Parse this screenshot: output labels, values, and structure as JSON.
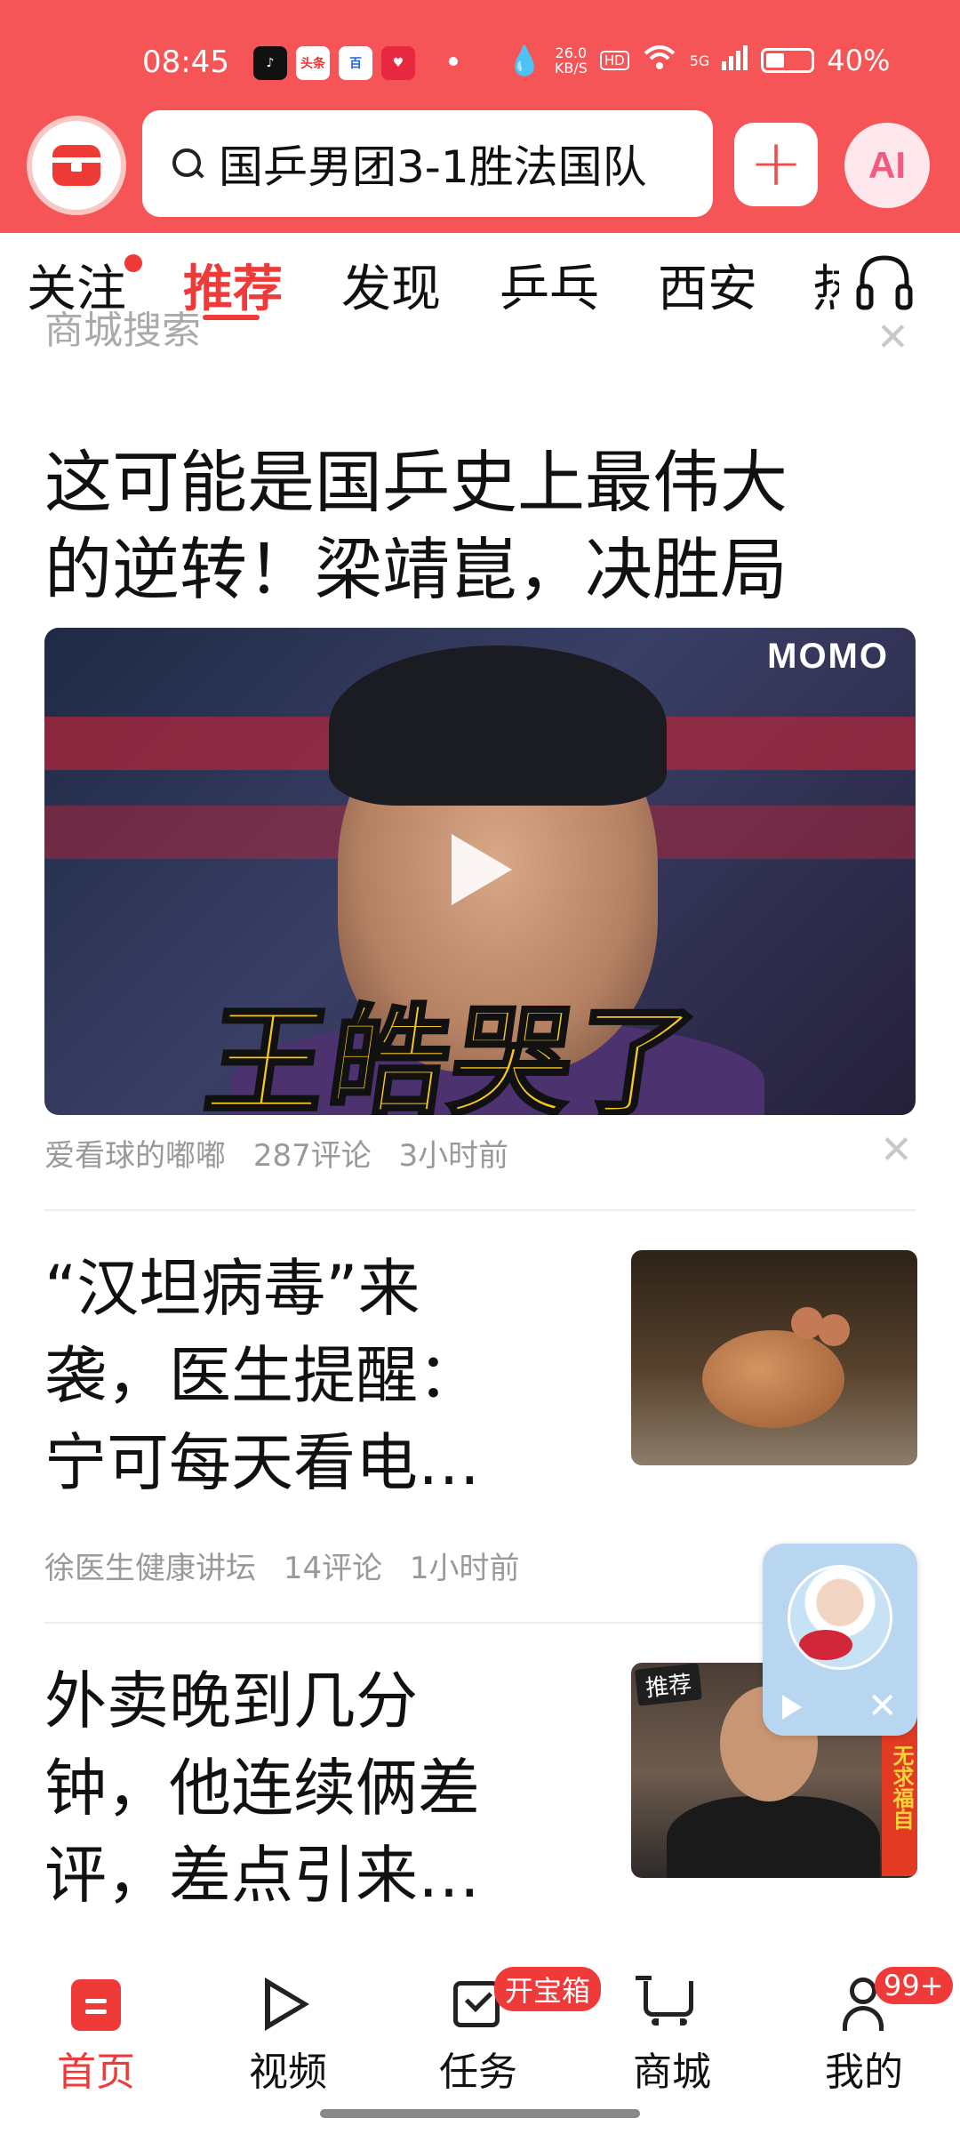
{
  "status_bar": {
    "time": "08:45",
    "app_icons": [
      "tiktok-icon",
      "toutiao-icon",
      "baidu-icon",
      "heart-app-icon"
    ],
    "app_labels": [
      "♪",
      "头条",
      "百",
      "♥"
    ],
    "speed_value": "26.0",
    "speed_unit": "KB/S",
    "hd": "HD",
    "network": "5G",
    "battery": "40%",
    "battery_level": 0.4
  },
  "header": {
    "search_query": "国乒男团3-1胜法国队",
    "plus_label": "+",
    "ai_label": "AI"
  },
  "tabs": [
    {
      "label": "关注",
      "has_dot": true
    },
    {
      "label": "推荐",
      "active": true
    },
    {
      "label": "发现"
    },
    {
      "label": "乒乓"
    },
    {
      "label": "西安"
    },
    {
      "label": "热"
    }
  ],
  "feed": {
    "partial_label": "商城搜索",
    "items": [
      {
        "title_line1": "这可能是国乒史上最伟大",
        "title_line2": "的逆转！梁靖崑，决胜局",
        "video_caption": "王皓哭了",
        "video_brand": "MOMO",
        "author": "爱看球的嘟嘟",
        "comments": "287评论",
        "time": "3小时前"
      },
      {
        "title_line1": "“汉坦病毒”来",
        "title_line2": "袭，医生提醒：",
        "title_line3": "宁可每天看电…",
        "author": "徐医生健康讲坛",
        "comments": "14评论",
        "time": "1小时前"
      },
      {
        "title_line1": "外卖晚到几分",
        "title_line2": "钟，他连续俩差",
        "title_line3": "评，差点引来…",
        "thumb_badge": "推荐",
        "thumb_sign": "无求福自"
      }
    ]
  },
  "floater": {
    "close": "✕"
  },
  "bottom_nav": [
    {
      "label": "首页",
      "active": true
    },
    {
      "label": "视频"
    },
    {
      "label": "任务",
      "badge": "开宝箱"
    },
    {
      "label": "商城"
    },
    {
      "label": "我的",
      "badge": "99+"
    }
  ],
  "colors": {
    "brand_red": "#f55556",
    "accent_red": "#ef3a3a"
  }
}
